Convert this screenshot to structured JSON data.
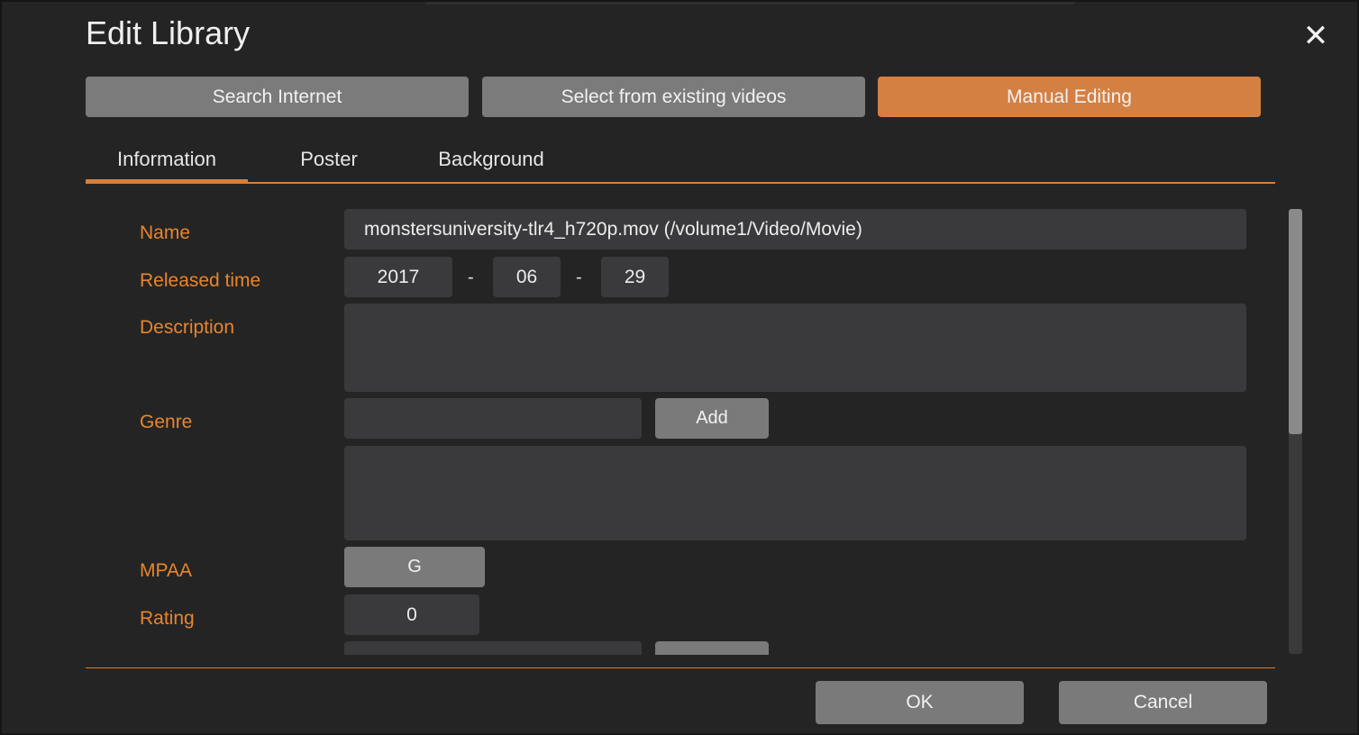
{
  "dialog": {
    "title": "Edit Library",
    "close_glyph": "✕"
  },
  "modes": [
    {
      "label": "Search Internet",
      "active": false
    },
    {
      "label": "Select from existing videos",
      "active": false
    },
    {
      "label": "Manual Editing",
      "active": true
    }
  ],
  "tabs": [
    {
      "label": "Information",
      "active": true
    },
    {
      "label": "Poster",
      "active": false
    },
    {
      "label": "Background",
      "active": false
    }
  ],
  "form": {
    "name_label": "Name",
    "name_value": "monstersuniversity-tlr4_h720p.mov (/volume1/Video/Movie)",
    "released_label": "Released time",
    "released_year": "2017",
    "released_month": "06",
    "released_day": "29",
    "date_separator": "-",
    "description_label": "Description",
    "description_value": "",
    "genre_label": "Genre",
    "genre_input": "",
    "genre_add_label": "Add",
    "mpaa_label": "MPAA",
    "mpaa_value": "G",
    "rating_label": "Rating",
    "rating_value": "0"
  },
  "footer": {
    "ok_label": "OK",
    "cancel_label": "Cancel"
  },
  "colors": {
    "accent": "#d48043",
    "label": "#e8852e",
    "panel": "#242424",
    "field": "#3a3a3c",
    "button": "#7a7a7a"
  }
}
